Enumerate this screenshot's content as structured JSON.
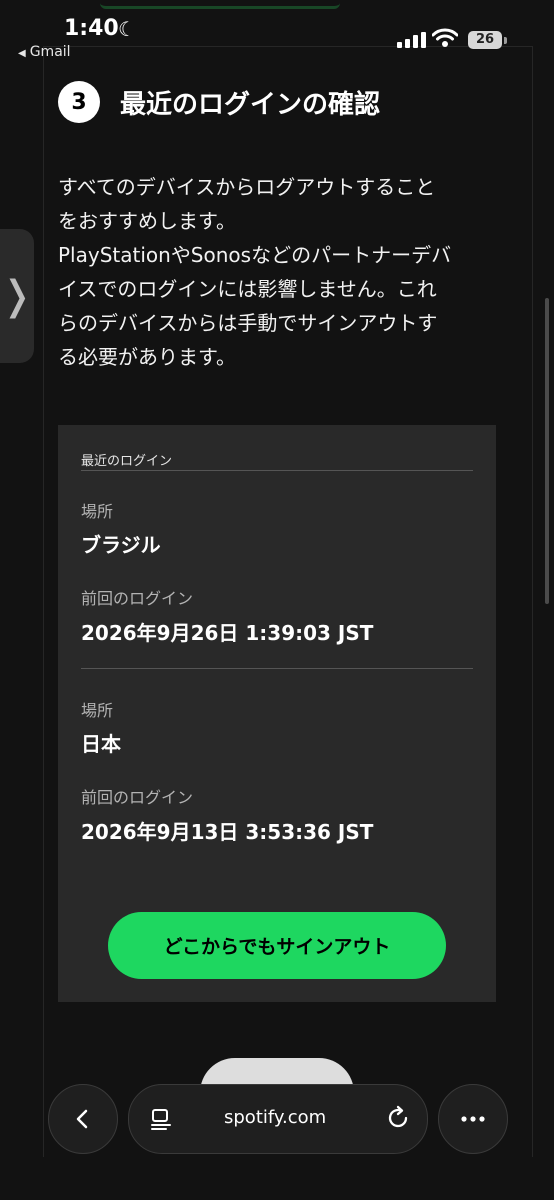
{
  "status_bar": {
    "time": "1:40",
    "back_app": "Gmail",
    "battery": "26"
  },
  "step": {
    "number": "3",
    "title": "最近のログインの確認",
    "description_lines": [
      "すべてのデバイスからログアウトすること",
      "をおすすめします。",
      "PlayStationやSonosなどのパートナーデバ",
      "イスでのログインには影響しません。これ",
      "らのデバイスからは手動でサインアウトす",
      "る必要があります。"
    ]
  },
  "recent_logins": {
    "heading": "最近のログイン",
    "entries": [
      {
        "location_label": "場所",
        "location": "ブラジル",
        "last_login_label": "前回のログイン",
        "last_login": "2026年9月26日 1:39:03 JST"
      },
      {
        "location_label": "場所",
        "location": "日本",
        "last_login_label": "前回のログイン",
        "last_login": "2026年9月13日 3:53:36 JST"
      }
    ],
    "signout_button": "どこからでもサインアウト"
  },
  "browser": {
    "url": "spotify.com"
  },
  "colors": {
    "accent": "#1ed760",
    "background": "#121212",
    "card": "#292929"
  }
}
